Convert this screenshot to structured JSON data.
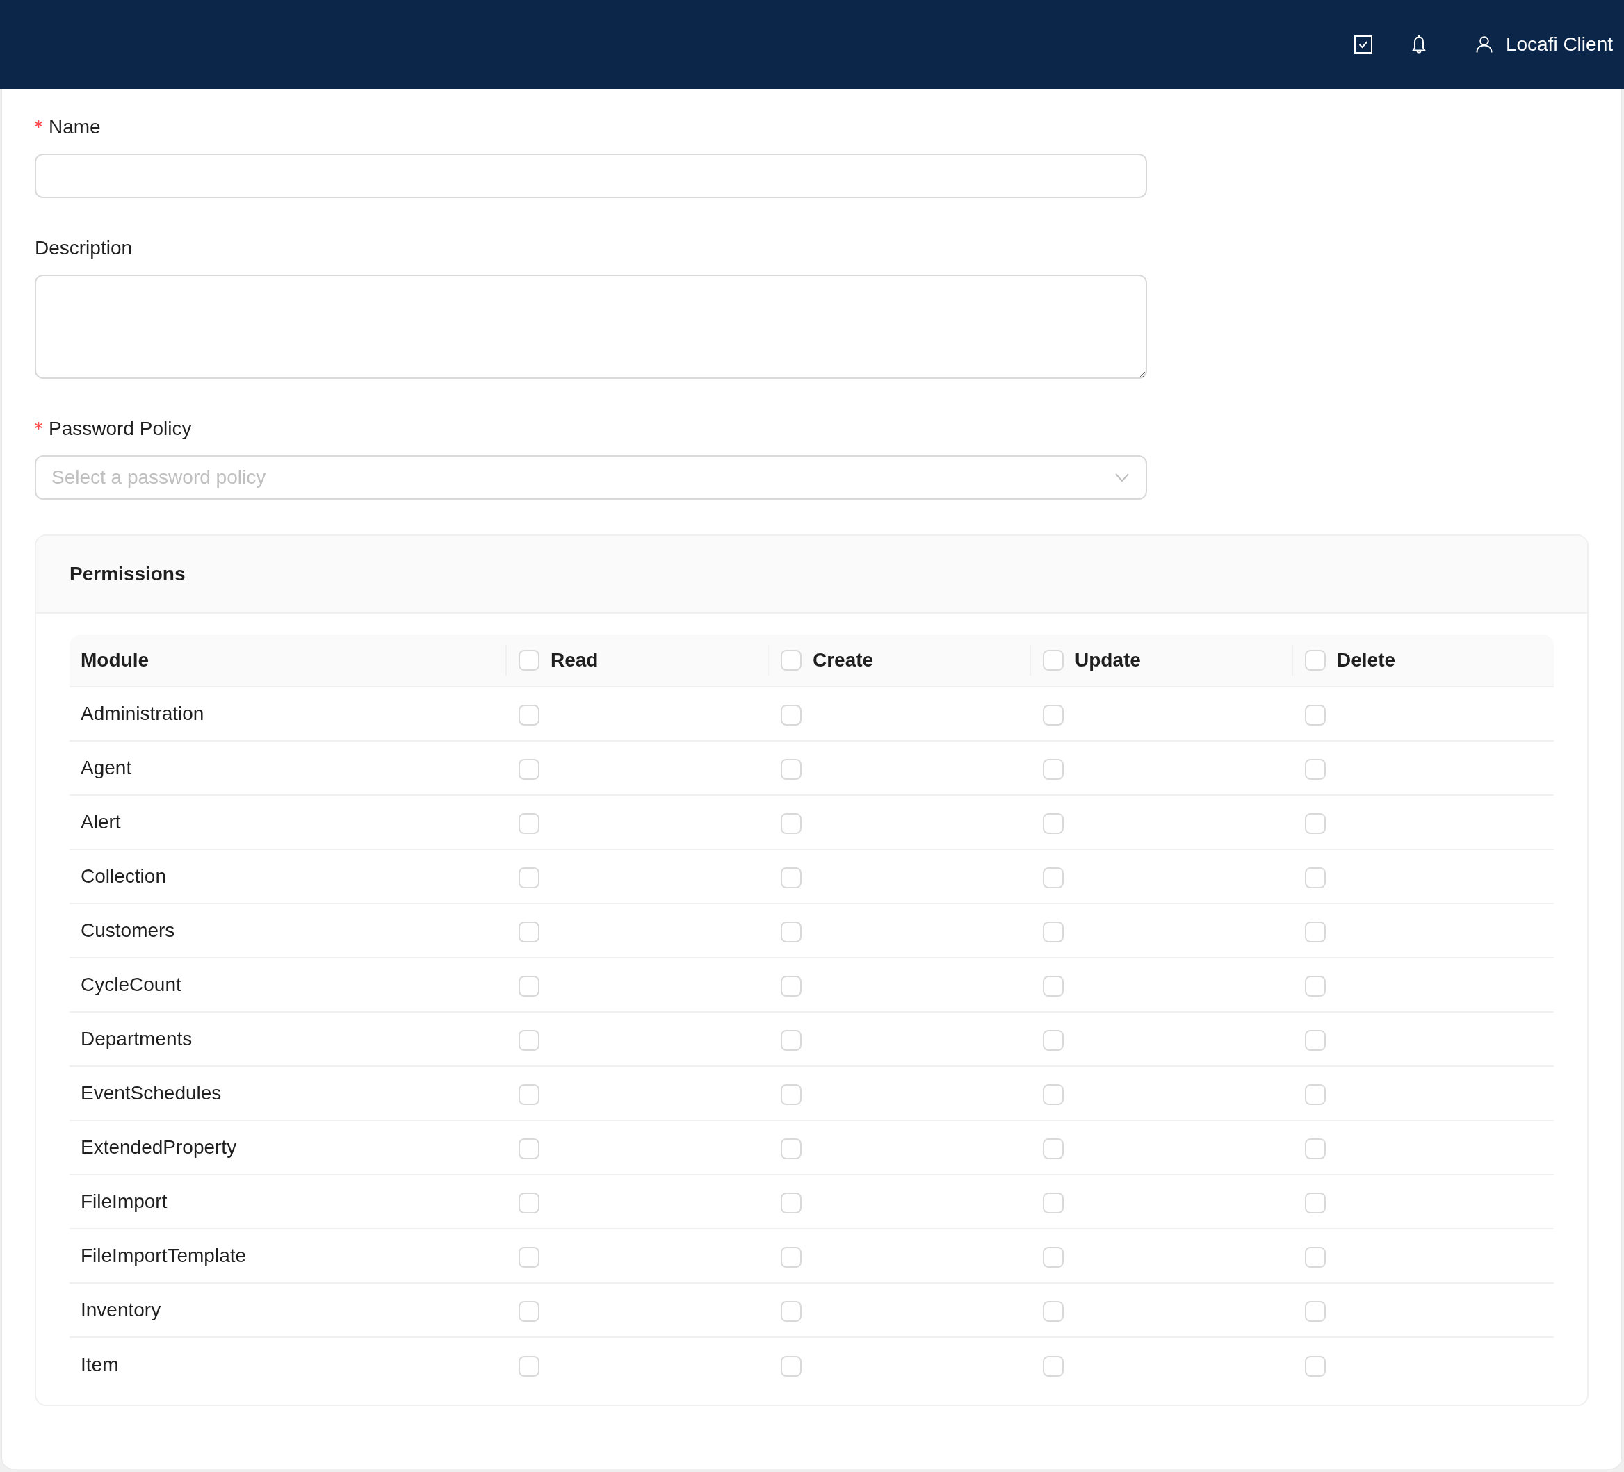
{
  "top_bar": {
    "user_name": "Locafi Client"
  },
  "form": {
    "fields": [
      {
        "kind": "input",
        "label": "Name",
        "required": true
      },
      {
        "kind": "textarea",
        "label": "Description",
        "required": false
      },
      {
        "kind": "select",
        "label": "Password Policy",
        "required": true,
        "placeholder": "Select a password policy"
      }
    ]
  },
  "permissions": {
    "title": "Permissions",
    "module_column": "Module",
    "columns": [
      {
        "label": "Read",
        "checked": false
      },
      {
        "label": "Create",
        "checked": false
      },
      {
        "label": "Update",
        "checked": false
      },
      {
        "label": "Delete",
        "checked": false
      }
    ],
    "rows": [
      {
        "module": "Administration",
        "checked": [
          false,
          false,
          false,
          false
        ]
      },
      {
        "module": "Agent",
        "checked": [
          false,
          false,
          false,
          false
        ]
      },
      {
        "module": "Alert",
        "checked": [
          false,
          false,
          false,
          false
        ]
      },
      {
        "module": "Collection",
        "checked": [
          false,
          false,
          false,
          false
        ]
      },
      {
        "module": "Customers",
        "checked": [
          false,
          false,
          false,
          false
        ]
      },
      {
        "module": "CycleCount",
        "checked": [
          false,
          false,
          false,
          false
        ]
      },
      {
        "module": "Departments",
        "checked": [
          false,
          false,
          false,
          false
        ]
      },
      {
        "module": "EventSchedules",
        "checked": [
          false,
          false,
          false,
          false
        ]
      },
      {
        "module": "ExtendedProperty",
        "checked": [
          false,
          false,
          false,
          false
        ]
      },
      {
        "module": "FileImport",
        "checked": [
          false,
          false,
          false,
          false
        ]
      },
      {
        "module": "FileImportTemplate",
        "checked": [
          false,
          false,
          false,
          false
        ]
      },
      {
        "module": "Inventory",
        "checked": [
          false,
          false,
          false,
          false
        ]
      },
      {
        "module": "Item",
        "checked": [
          false,
          false,
          false,
          false
        ]
      }
    ]
  }
}
